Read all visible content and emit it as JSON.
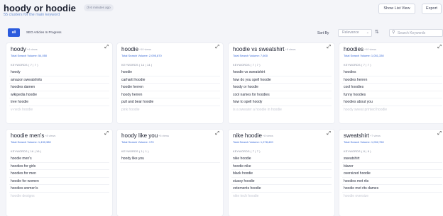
{
  "header": {
    "title": "hoody or hoodie",
    "time_badge": "6 minutes ago",
    "subtitle": "55 clusters for the main keyword",
    "show_list_view": "Show List View",
    "export": "Export"
  },
  "toolbar": {
    "tab_all": "all",
    "tab_seo": "SEO Articles In Progress",
    "sort_label": "Sort By",
    "sort_value": "Relevance",
    "search_placeholder": "Search Keywords"
  },
  "colors": {
    "accent": "#2b5bdd",
    "link": "#3466d6",
    "subtitle": "#6a8fd1"
  },
  "clusters": [
    {
      "title": "hoody",
      "views": "+4 views",
      "volume": "Total Search Volume: 54,050",
      "kw_head": "KEYWORDS ( 7 | 7 )",
      "keywords": [
        "hoody",
        "amazon sweatshirts",
        "hoodies damen",
        "wikipedia hoodie",
        "tree hoodie",
        "v-neck hoodie"
      ]
    },
    {
      "title": "hoodie",
      "views": "+10 views",
      "volume": "Total Search Volume: 2,095,870",
      "kw_head": "KEYWORDS ( 14 | 14 )",
      "keywords": [
        "hoodie",
        "carhartt hoodie",
        "hoodie herren",
        "hoody herren",
        "pull and bear hoodie",
        "pink hoodie"
      ]
    },
    {
      "title": "hoodie vs sweatshirt",
      "views": "+8 views",
      "volume": "Total Search Volume: 7,600",
      "kw_head": "KEYWORDS ( 7 | 7 )",
      "keywords": [
        "hoodie vs sweatshirt",
        "how do you spell hoodie",
        "hoody or hoodie",
        "cool names for hoodies",
        "how to spell hoody",
        "is a sweater a hoodie in hoodie"
      ]
    },
    {
      "title": "hoodies",
      "views": "+10 views",
      "volume": "Total Search Volume: 1,051,330",
      "kw_head": "KEYWORDS ( 7 | 7 )",
      "keywords": [
        "hoodies",
        "hoodies herren",
        "cool hoodies",
        "funny hoodies",
        "hoodies about you",
        "hoody sweat printed hoodie"
      ]
    },
    {
      "title": "hoodie men's",
      "views": "+8 views",
      "volume": "Total Search Volume: 1,430,380",
      "kw_head": "KEYWORDS ( 16 | 16 )",
      "keywords": [
        "hoodie men's",
        "hoodies for girls",
        "hoodies for men",
        "hoodie for women",
        "hoodies women's",
        "hoodie designs"
      ]
    },
    {
      "title": "hoody like you",
      "views": "+6 views",
      "volume": "Total Search Volume: 170",
      "kw_head": "KEYWORDS ( 1 | 1 )",
      "keywords": [
        "hoody like you"
      ]
    },
    {
      "title": "nike hoodie",
      "views": "+8 views",
      "volume": "Total Search Volume: 1,278,420",
      "kw_head": "KEYWORDS ( 7 | 7 )",
      "keywords": [
        "nike hoodie",
        "hoodie nike",
        "black hoodie",
        "stussy hoodie",
        "vetements hoodie",
        "nike tech hoodie"
      ]
    },
    {
      "title": "sweatshirt",
      "views": "+7 views",
      "volume": "Total Search Volume: 1,052,760",
      "kw_head": "KEYWORDS ( 8 | 8 )",
      "keywords": [
        "sweatshirt",
        "blazer",
        "oversized hoodie",
        "hoodies met rits",
        "hoodie met rits dames",
        "hoodie oversize"
      ]
    }
  ]
}
